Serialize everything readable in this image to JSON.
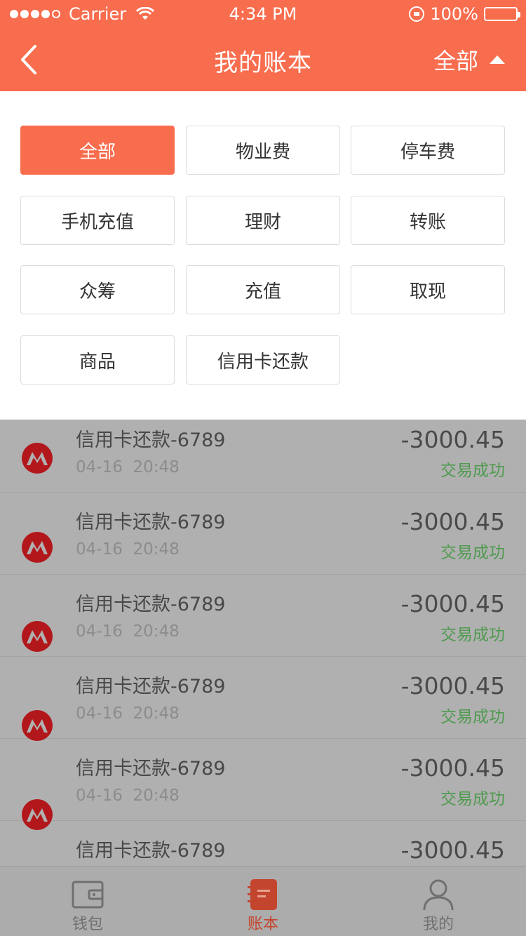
{
  "status_bar": {
    "carrier": "Carrier",
    "time": "4:34 PM",
    "battery": "100%"
  },
  "nav": {
    "title": "我的账本",
    "filter_label": "全部"
  },
  "filters": [
    {
      "label": "全部",
      "active": true
    },
    {
      "label": "物业费",
      "active": false
    },
    {
      "label": "停车费",
      "active": false
    },
    {
      "label": "手机充值",
      "active": false
    },
    {
      "label": "理财",
      "active": false
    },
    {
      "label": "转账",
      "active": false
    },
    {
      "label": "众筹",
      "active": false
    },
    {
      "label": "充值",
      "active": false
    },
    {
      "label": "取现",
      "active": false
    },
    {
      "label": "商品",
      "active": false
    },
    {
      "label": "信用卡还款",
      "active": false
    }
  ],
  "transactions": [
    {
      "title": "信用卡还款-6789",
      "date": "04-16",
      "time": "20:48",
      "amount": "-3000.45",
      "status": "交易成功"
    },
    {
      "title": "信用卡还款-6789",
      "date": "04-16",
      "time": "20:48",
      "amount": "-3000.45",
      "status": "交易成功"
    },
    {
      "title": "信用卡还款-6789",
      "date": "04-16",
      "time": "20:48",
      "amount": "-3000.45",
      "status": "交易成功"
    },
    {
      "title": "信用卡还款-6789",
      "date": "04-16",
      "time": "20:48",
      "amount": "-3000.45",
      "status": "交易成功"
    },
    {
      "title": "信用卡还款-6789",
      "date": "04-16",
      "time": "20:48",
      "amount": "-3000.45",
      "status": "交易成功"
    },
    {
      "title": "信用卡还款-6789",
      "amount": "-3000.45"
    }
  ],
  "tabs": [
    {
      "label": "钱包",
      "icon": "wallet-icon",
      "active": false
    },
    {
      "label": "账本",
      "icon": "ledger-icon",
      "active": true
    },
    {
      "label": "我的",
      "icon": "profile-icon",
      "active": false
    }
  ],
  "colors": {
    "brand": "#f86d4e",
    "success": "#4f9a4f",
    "bank_logo": "#b2171b"
  }
}
